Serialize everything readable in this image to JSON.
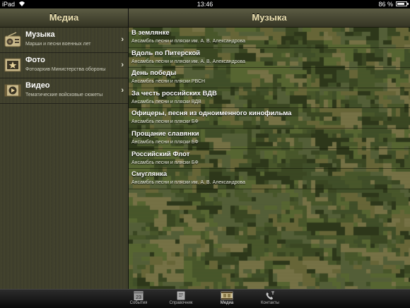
{
  "status_bar": {
    "carrier": "iPad",
    "time": "13:46",
    "battery": "86 %",
    "battery_level": 0.86
  },
  "left_header": {
    "title": "Медиа"
  },
  "right_header": {
    "title": "Музыка"
  },
  "menu": [
    {
      "icon": "radio-icon",
      "title": "Музыка",
      "subtitle": "Марши и песни военных лет"
    },
    {
      "icon": "photo-icon",
      "title": "Фото",
      "subtitle": "Фотоархив Министерства обороны"
    },
    {
      "icon": "video-icon",
      "title": "Видео",
      "subtitle": "Тематические войсковые сюжеты"
    }
  ],
  "tracks": [
    {
      "title": "В землянке",
      "artist": "Ансамбль песни и пляски им. А. В. Александрова"
    },
    {
      "title": "Вдоль по Питерской",
      "artist": "Ансамбль песни и пляски им. А. В. Александрова"
    },
    {
      "title": "День победы",
      "artist": "Ансамбль песни и пляски РВСН"
    },
    {
      "title": "За честь российских ВДВ",
      "artist": "Ансамбль песни и пляски ВДВ"
    },
    {
      "title": "Офицеры, песня из одноименного кинофильма",
      "artist": "Ансамбль песни и пляски БФ"
    },
    {
      "title": "Прощание славянки",
      "artist": "Ансамбль песни и пляски БФ"
    },
    {
      "title": "Российский Флот",
      "artist": "Ансамбль песни и пляски БФ"
    },
    {
      "title": "Смуглянка",
      "artist": "Ансамбль песни и пляски им. А. В. Александрова"
    }
  ],
  "tabs": [
    {
      "icon": "calendar-icon",
      "label": "События",
      "calendar_day": "23",
      "active": false
    },
    {
      "icon": "book-icon",
      "label": "Справочник",
      "active": false
    },
    {
      "icon": "film-icon",
      "label": "Медиа",
      "active": true
    },
    {
      "icon": "phone-icon",
      "label": "Контакты",
      "active": false
    }
  ],
  "colors": {
    "header_text": "#efe3b3",
    "camo": [
      "#3d4a24",
      "#4b5a2c",
      "#5a6a34",
      "#6b6a3a",
      "#2f3a1c",
      "#57623a",
      "#43522a",
      "#7a7648"
    ]
  }
}
